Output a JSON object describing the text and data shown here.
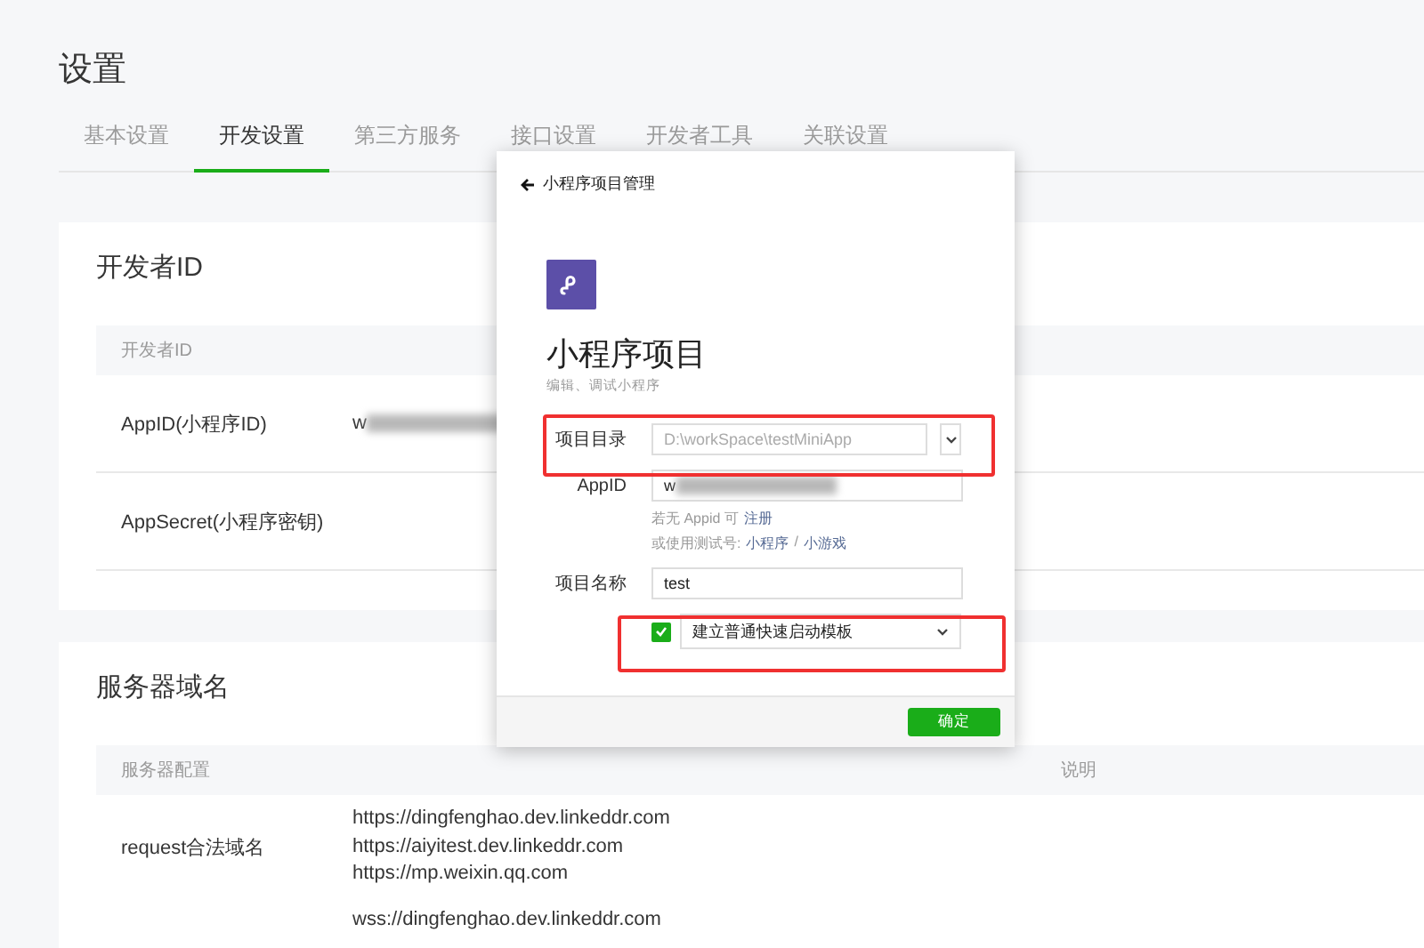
{
  "page_title": "设置",
  "tabs": [
    {
      "label": "基本设置",
      "selected": false
    },
    {
      "label": "开发设置",
      "selected": true
    },
    {
      "label": "第三方服务",
      "selected": false
    },
    {
      "label": "接口设置",
      "selected": false
    },
    {
      "label": "开发者工具",
      "selected": false
    },
    {
      "label": "关联设置",
      "selected": false
    }
  ],
  "developer_card": {
    "title": "开发者ID",
    "header": "开发者ID",
    "rows": [
      {
        "label": "AppID(小程序ID)",
        "value": "w",
        "redacted": true
      },
      {
        "label": "AppSecret(小程序密钥)"
      }
    ]
  },
  "server_card": {
    "title": "服务器域名",
    "columns": [
      "服务器配置",
      "说明"
    ],
    "rows": [
      {
        "label": "request合法域名",
        "values": [
          "https://dingfenghao.dev.linkeddr.com",
          "https://aiyitest.dev.linkeddr.com",
          "https://mp.weixin.qq.com"
        ]
      },
      {
        "values": [
          "wss://dingfenghao.dev.linkeddr.com"
        ]
      }
    ]
  },
  "dialog": {
    "back": "小程序项目管理",
    "title": "小程序项目",
    "subtitle": "编辑、调试小程序",
    "fields": [
      {
        "kind": "directory",
        "label": "项目目录",
        "placeholder": "D:\\workSpace\\testMiniApp"
      },
      {
        "kind": "text",
        "label": "AppID",
        "value": "w",
        "redacted": true
      },
      {
        "kind": "hint",
        "lines": [
          [
            {
              "kind": "text",
              "text": "若无 Appid 可"
            },
            {
              "kind": "link",
              "text": "注册"
            }
          ],
          [
            {
              "kind": "text",
              "text": "或使用测试号:"
            },
            {
              "kind": "link",
              "text": "小程序"
            },
            {
              "kind": "text",
              "text": "/"
            },
            {
              "kind": "link",
              "text": "小游戏"
            }
          ]
        ]
      },
      {
        "kind": "text",
        "label": "项目名称",
        "value": "test"
      },
      {
        "kind": "template",
        "checked": true,
        "value": "建立普通快速启动模板"
      }
    ],
    "confirm": "确定"
  }
}
